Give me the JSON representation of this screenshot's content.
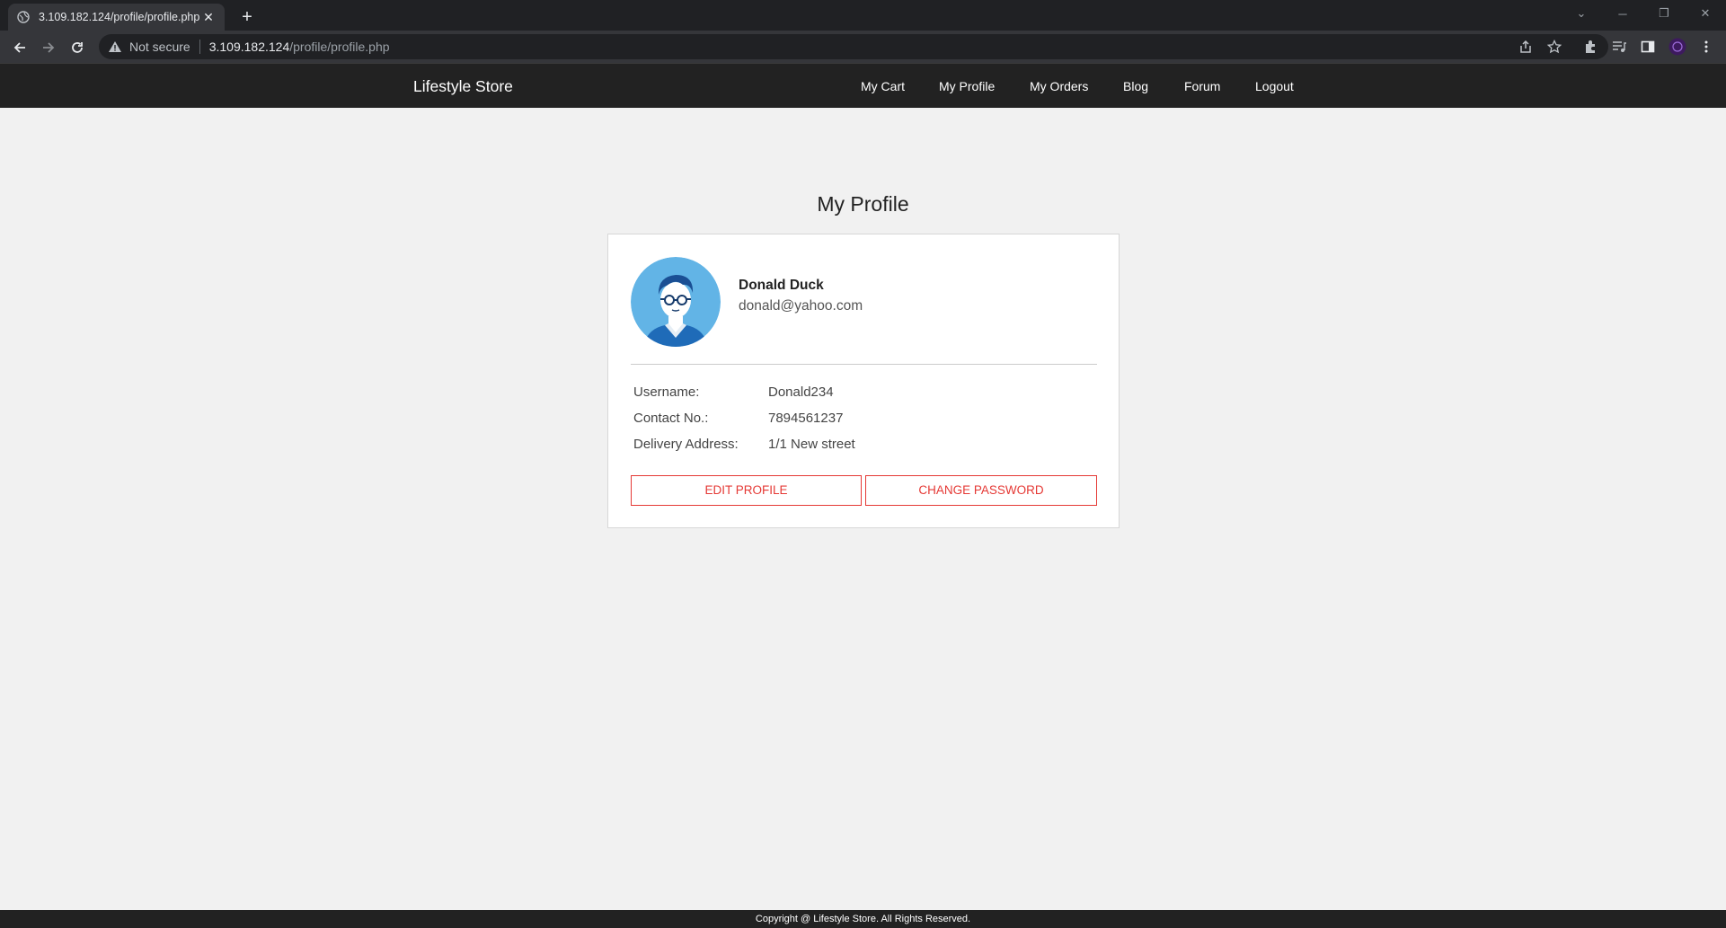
{
  "browser": {
    "tab_title": "3.109.182.124/profile/profile.php",
    "security_label": "Not secure",
    "url_host": "3.109.182.124",
    "url_path": "/profile/profile.php"
  },
  "site": {
    "brand": "Lifestyle Store",
    "nav": [
      {
        "label": "My Cart"
      },
      {
        "label": "My Profile"
      },
      {
        "label": "My Orders"
      },
      {
        "label": "Blog"
      },
      {
        "label": "Forum"
      },
      {
        "label": "Logout"
      }
    ]
  },
  "profile": {
    "heading": "My Profile",
    "name": "Donald Duck",
    "email": "donald@yahoo.com",
    "fields": [
      {
        "label": "Username:",
        "value": "Donald234"
      },
      {
        "label": "Contact No.:",
        "value": "7894561237"
      },
      {
        "label": "Delivery Address:",
        "value": "1/1 New street"
      }
    ],
    "edit_button": "EDIT PROFILE",
    "password_button": "CHANGE PASSWORD"
  },
  "footer": {
    "text": "Copyright @ Lifestyle Store. All Rights Reserved."
  },
  "colors": {
    "accent": "#e53935",
    "navbar": "#222222",
    "page_bg": "#f1f1f1",
    "avatar_bg": "#62b4e6"
  }
}
